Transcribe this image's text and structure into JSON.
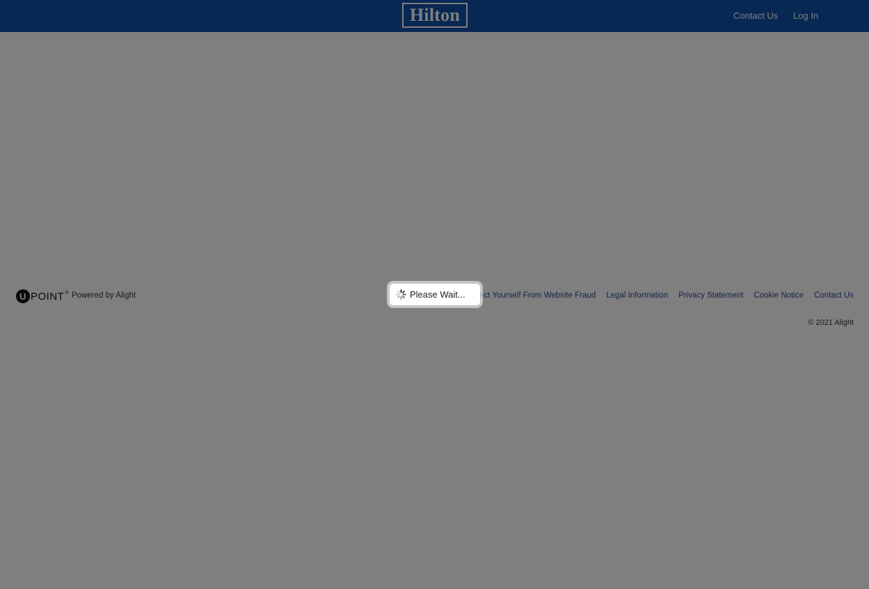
{
  "header": {
    "logo_text": "Hilton",
    "nav": {
      "contact": "Contact Us",
      "login": "Log In"
    }
  },
  "footer": {
    "brand_text": "POINT",
    "brand_letter": "U",
    "brand_tm": "®",
    "powered_by": "Powered by Alight",
    "links": [
      "Protect Yourself From Website Fraud",
      "Legal Information",
      "Privacy Statement",
      "Cookie Notice",
      "Contact Us"
    ],
    "copyright": "© 2021 Alight"
  },
  "overlay": {
    "message": "Please Wait..."
  },
  "colors": {
    "header_bg": "#1050a8",
    "link": "#2a4a8a",
    "overlay": "rgba(0,0,0,0.5)"
  },
  "icons": {
    "spinner": "loading-spinner-icon"
  }
}
